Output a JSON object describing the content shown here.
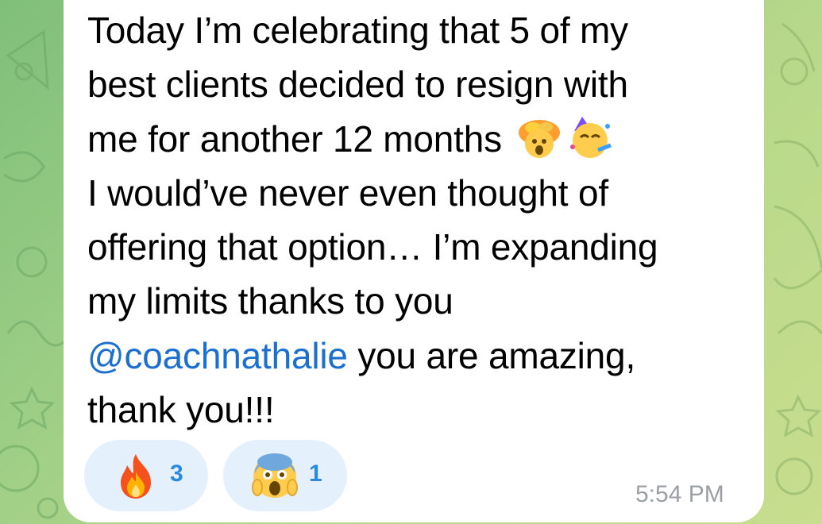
{
  "message": {
    "lines": [
      "Today I’m celebrating that 5 of my",
      "best clients decided to resign with",
      "me for another 12 months",
      "I would’ve never even thought of",
      "offering that option… I’m expanding",
      "my limits thanks to you"
    ],
    "mention": "@coachnathalie",
    "mention_suffix": " you are amazing,",
    "last_line": "thank you!!!",
    "inline_emojis": [
      "exploding-head-emoji",
      "partying-face-emoji"
    ],
    "mention_color": "#1a6fcf"
  },
  "reactions": [
    {
      "emoji": "fire-emoji",
      "count": "3"
    },
    {
      "emoji": "screaming-face-emoji",
      "count": "1"
    }
  ],
  "timestamp": "5:54 PM",
  "colors": {
    "bubble": "#ffffff",
    "reaction_bg": "#e4f0fb",
    "reaction_count": "#2b8ae0",
    "timestamp": "#9aa0a6",
    "wallpaper": "#9fcf86"
  }
}
